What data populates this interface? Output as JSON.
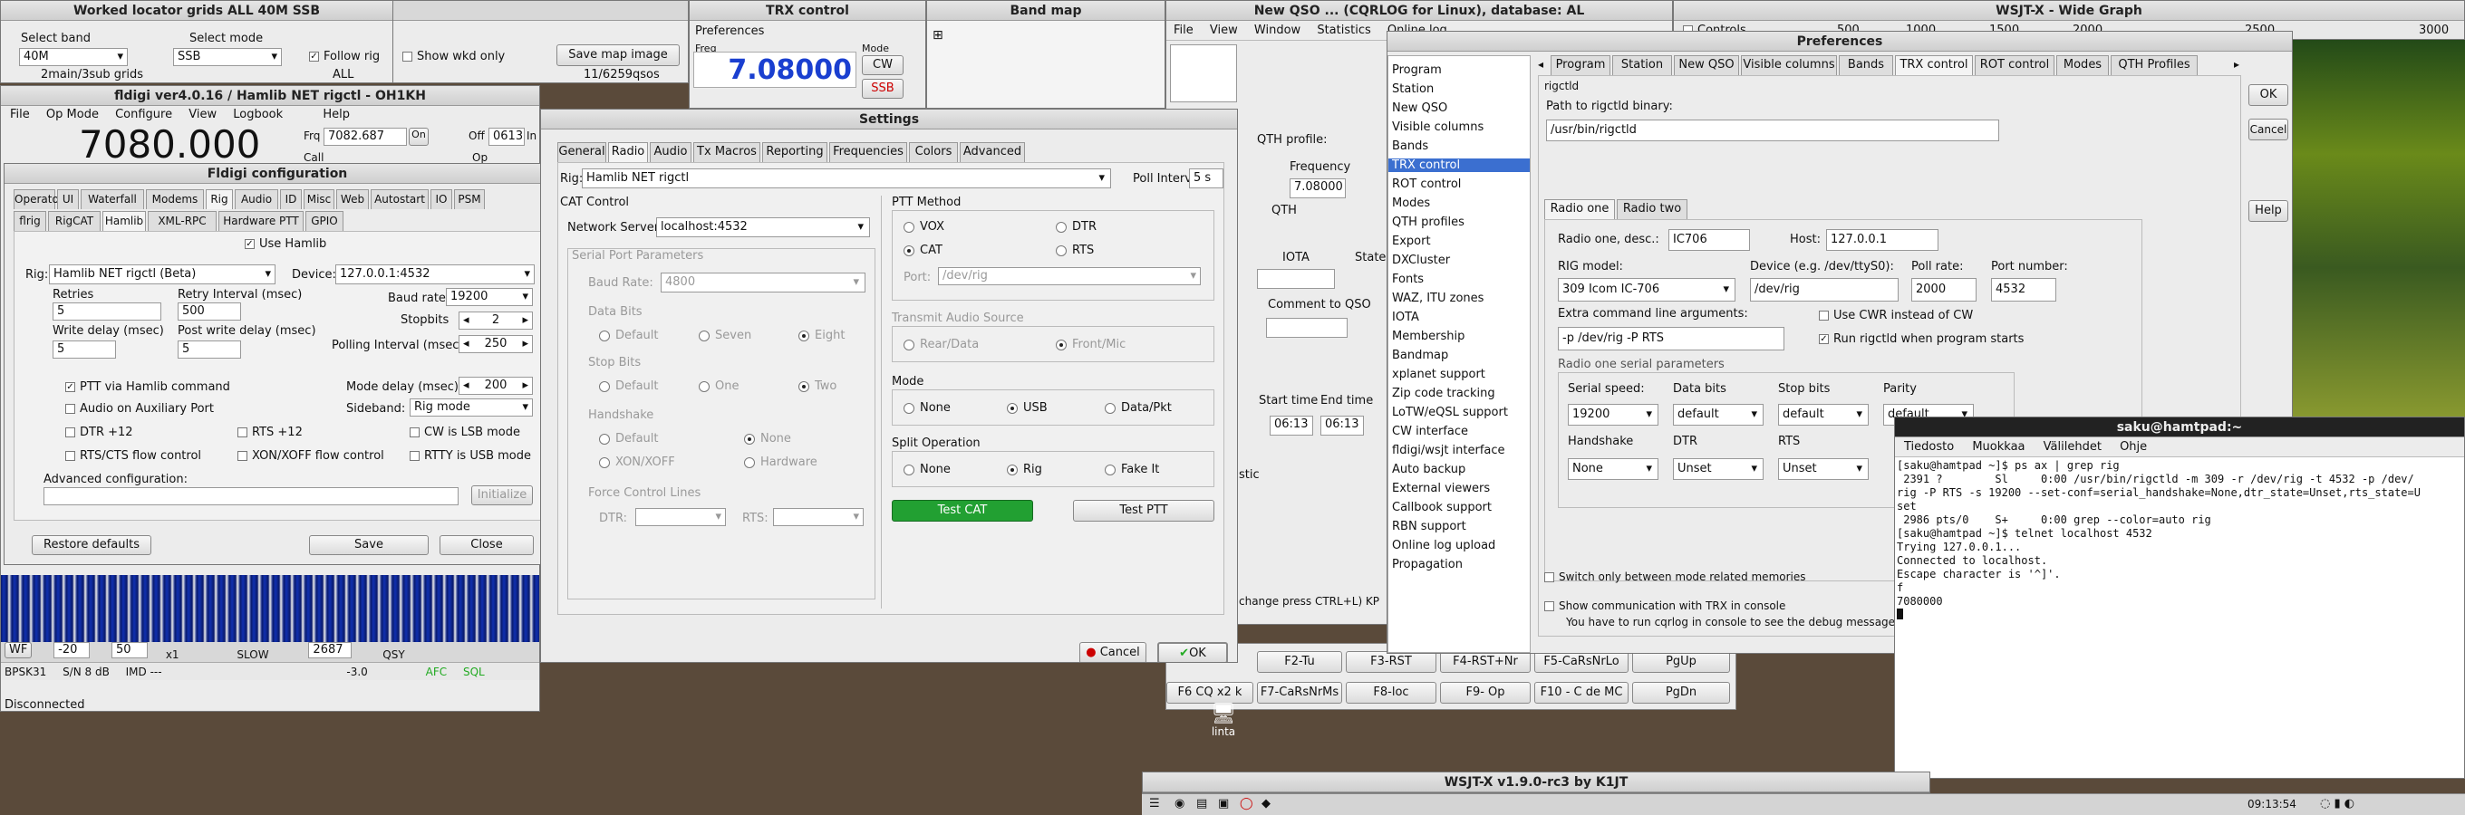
{
  "locator": {
    "title": "Worked locator grids ALL 40M SSB",
    "band_label": "Select band",
    "band_value": "40M",
    "band_sub": "2main/3sub grids",
    "mode_label": "Select mode",
    "mode_value": "SSB",
    "mode_sub": "ALL",
    "follow_rig": "Follow rig",
    "show_wkd": "Show wkd only",
    "save_button": "Save map image",
    "count": "11/6259qsos"
  },
  "trx": {
    "title": "TRX control",
    "prefs": "Preferences",
    "freq_label": "Freq",
    "freq_value": "7.08000",
    "mode_label": "Mode",
    "cw": "CW",
    "ssb": "SSB"
  },
  "bandmap": {
    "title": "Band map"
  },
  "newqso": {
    "title": "New QSO ... (CQRLOG for Linux), database: AL",
    "menus": [
      "File",
      "View",
      "Window",
      "Statistics",
      "Online log"
    ],
    "qth_profile": "QTH profile:",
    "frequency": "Frequency",
    "freq_value": "7.08000",
    "qth": "QTH",
    "iota": "IOTA",
    "state": "State",
    "comment": "Comment to QSO",
    "start_time": "Start time",
    "end_time": "End time",
    "start_value": "06:13",
    "end_value": "06:13",
    "stic": "stic",
    "hint": "change press CTRL+L) KP"
  },
  "wsjtx_wide": {
    "title": "WSJT-X - Wide Graph",
    "controls": "Controls",
    "ticks": [
      "500",
      "1000",
      "1500",
      "2000",
      "2500",
      "3000"
    ]
  },
  "cqprefs": {
    "title": "Preferences",
    "nav": [
      "Program",
      "Station",
      "New QSO",
      "Visible columns",
      "Bands",
      "TRX control",
      "ROT control",
      "Modes",
      "QTH profiles",
      "Export",
      "DXCluster",
      "Fonts",
      "WAZ, ITU zones",
      "IOTA",
      "Membership",
      "Bandmap",
      "xplanet support",
      "Zip code tracking",
      "LoTW/eQSL support",
      "CW interface",
      "fldigi/wsjt interface",
      "Auto backup",
      "External viewers",
      "Callbook support",
      "RBN support",
      "Online log upload",
      "Propagation"
    ],
    "tabs": [
      "Program",
      "Station",
      "New QSO",
      "Visible columns",
      "Bands",
      "TRX control",
      "ROT control",
      "Modes",
      "QTH Profiles"
    ],
    "rigctld": "rigctld",
    "path_label": "Path to rigctld binary:",
    "path_value": "/usr/bin/rigctld",
    "radio_tabs": [
      "Radio one",
      "Radio two"
    ],
    "desc_label": "Radio one, desc.:",
    "desc_value": "IC706",
    "host_label": "Host:",
    "host_value": "127.0.0.1",
    "model_label": "RIG model:",
    "model_value": "309 Icom IC-706",
    "device_label": "Device (e.g. /dev/ttyS0):",
    "device_value": "/dev/rig",
    "poll_label": "Poll rate:",
    "poll_value": "2000",
    "port_label": "Port number:",
    "port_value": "4532",
    "extra_label": "Extra command line arguments:",
    "extra_value": "-p /dev/rig -P RTS",
    "use_cwr": "Use CWR instead of CW",
    "run_rigctld": "Run rigctld when program starts",
    "serial_group": "Radio one serial parameters",
    "speed_label": "Serial speed:",
    "speed_value": "19200",
    "data_bits_label": "Data bits",
    "data_bits_value": "default",
    "stop_bits_label": "Stop bits",
    "stop_bits_value": "default",
    "parity_label": "Parity",
    "parity_value": "default",
    "handshake_label": "Handshake",
    "handshake_value": "None",
    "dtr_label": "DTR",
    "dtr_value": "Unset",
    "rts_label": "RTS",
    "rts_value": "Unset",
    "switch_only": "Switch only between mode related memories",
    "show_comm": "Show communication with TRX in console",
    "console_hint": "You have to run cqrlog in console to see the debug messages",
    "ok": "OK",
    "cancel": "Cancel",
    "help": "Help"
  },
  "fldigi_main": {
    "title": "fldigi ver4.0.16 / Hamlib NET rigctl - OH1KH",
    "menus": [
      "File",
      "Op Mode",
      "Configure",
      "View",
      "Logbook",
      "Help"
    ],
    "freq": "7080.000",
    "frq_label": "Frq",
    "frq_value": "7082.687",
    "on": "On",
    "off": "Off",
    "off_value": "0613",
    "in": "In",
    "call": "Call",
    "op": "Op",
    "wf": "WF",
    "wf_val1": "-20",
    "wf_val2": "50",
    "x1": "x1",
    "slow": "SLOW",
    "wf_freq": "2687",
    "qsy": "QSY",
    "mode": "BPSK31",
    "sn": "S/N  8 dB",
    "imd": "IMD ---",
    "status": "Disconnected",
    "afc": "AFC",
    "sql": "SQL",
    "db": "-3.0"
  },
  "fldigi_cfg": {
    "title": "Fldigi configuration",
    "tabs1": [
      "Operator",
      "UI",
      "Waterfall",
      "Modems",
      "Rig",
      "Audio",
      "ID",
      "Misc",
      "Web",
      "Autostart",
      "IO",
      "PSM"
    ],
    "tabs2": [
      "flrig",
      "RigCAT",
      "Hamlib",
      "XML-RPC",
      "Hardware PTT",
      "GPIO"
    ],
    "use_hamlib": "Use Hamlib",
    "rig_label": "Rig:",
    "rig_value": "Hamlib NET rigctl  (Beta)",
    "device_label": "Device:",
    "device_value": "127.0.0.1:4532",
    "retries_label": "Retries",
    "retries_value": "5",
    "retry_int_label": "Retry Interval (msec)",
    "retry_int_value": "500",
    "baud_label": "Baud rate:",
    "baud_value": "19200",
    "stopbits_label": "Stopbits",
    "stopbits_value": "2",
    "write_delay_label": "Write delay (msec)",
    "write_delay_value": "5",
    "post_write_label": "Post write delay (msec)",
    "post_write_value": "5",
    "polling_label": "Polling Interval (msec)",
    "polling_value": "250",
    "ptt_hamlib": "PTT via Hamlib command",
    "mode_delay_label": "Mode delay (msec)",
    "mode_delay_value": "200",
    "audio_aux": "Audio on Auxiliary Port",
    "sideband_label": "Sideband:",
    "sideband_value": "Rig mode",
    "dtr12": "DTR +12",
    "rts12": "RTS +12",
    "cw_lsb": "CW is LSB mode",
    "rtscts": "RTS/CTS flow control",
    "xonxoff": "XON/XOFF flow control",
    "rtty_usb": "RTTY is USB mode",
    "adv_label": "Advanced configuration:",
    "initialize": "Initialize",
    "restore": "Restore defaults",
    "save": "Save",
    "close": "Close"
  },
  "settings": {
    "title": "Settings",
    "tabs": [
      "General",
      "Radio",
      "Audio",
      "Tx Macros",
      "Reporting",
      "Frequencies",
      "Colors",
      "Advanced"
    ],
    "rig_label": "Rig:",
    "rig_value": "Hamlib NET rigctl",
    "poll_label": "Poll Interval:",
    "poll_value": "5 s",
    "cat_control": "CAT Control",
    "net_server_label": "Network Server:",
    "net_server_value": "localhost:4532",
    "serial_params": "Serial Port Parameters",
    "baud_label": "Baud Rate:",
    "baud_value": "4800",
    "data_bits": "Data Bits",
    "db_opts": [
      "Default",
      "Seven",
      "Eight"
    ],
    "stop_bits": "Stop Bits",
    "sb_opts": [
      "Default",
      "One",
      "Two"
    ],
    "handshake": "Handshake",
    "hs_opts": [
      "Default",
      "None",
      "XON/XOFF",
      "Hardware"
    ],
    "force_lines": "Force Control Lines",
    "dtr": "DTR:",
    "rts": "RTS:",
    "ptt_method": "PTT Method",
    "vox": "VOX",
    "dtr_opt": "DTR",
    "cat_opt": "CAT",
    "rts_opt": "RTS",
    "port_label": "Port:",
    "port_value": "/dev/rig",
    "tx_audio": "Transmit Audio Source",
    "rear": "Rear/Data",
    "front": "Front/Mic",
    "mode": "Mode",
    "mode_none": "None",
    "mode_usb": "USB",
    "mode_data": "Data/Pkt",
    "split": "Split Operation",
    "split_none": "None",
    "split_rig": "Rig",
    "split_fake": "Fake It",
    "test_cat": "Test CAT",
    "test_ptt": "Test PTT",
    "cancel": "Cancel",
    "ok": "OK"
  },
  "macros": {
    "row1": [
      "F2-Tu",
      "F3-RST",
      "F4-RST+Nr",
      "F5-CaRsNrLo",
      "PgUp"
    ],
    "row2": [
      "F6 CQ x2 k",
      "F7-CaRsNrMs",
      "F8-loc",
      "F9- Op",
      "F10 - C de MC",
      "PgDn"
    ]
  },
  "terminal": {
    "title": "saku@hamtpad:~",
    "menus": [
      "Tiedosto",
      "Muokkaa",
      "Välilehdet",
      "Ohje"
    ],
    "lines": [
      "[saku@hamtpad ~]$ ps ax | grep rig",
      " 2391 ?        Sl     0:00 /usr/bin/rigctld -m 309 -r /dev/rig -t 4532 -p /dev/",
      "rig -P RTS -s 19200 --set-conf=serial_handshake=None,dtr_state=Unset,rts_state=U",
      "set",
      " 2986 pts/0    S+     0:00 grep --color=auto rig",
      "[saku@hamtpad ~]$ telnet localhost 4532",
      "Trying 127.0.0.1...",
      "Connected to localhost.",
      "Escape character is '^]'.",
      "f",
      "7080000"
    ]
  },
  "wsjtx_main": {
    "title": "WSJT-X   v1.9.0-rc3   by K1JT"
  },
  "taskbar": {
    "clock": "09:13:54",
    "desktop_label": "linta"
  },
  "colors": {
    "freq_blue": "#1a3fd0",
    "test_cat_green": "#22a032",
    "selection": "#3b6fd0"
  }
}
